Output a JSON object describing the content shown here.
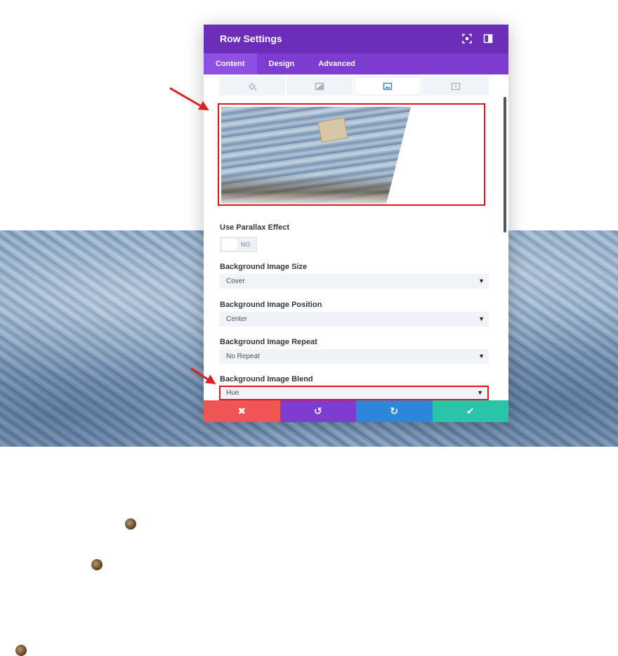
{
  "modal": {
    "title": "Row Settings",
    "header_icons": [
      "fullscreen-icon",
      "sidebar-toggle-icon"
    ]
  },
  "tabs": [
    {
      "label": "Content",
      "active": true
    },
    {
      "label": "Design",
      "active": false
    },
    {
      "label": "Advanced",
      "active": false
    }
  ],
  "background_tabs": [
    {
      "icon": "color-fill-icon",
      "active": false
    },
    {
      "icon": "gradient-icon",
      "active": false
    },
    {
      "icon": "image-icon",
      "active": true
    },
    {
      "icon": "video-icon",
      "active": false
    }
  ],
  "fields": {
    "parallax": {
      "label": "Use Parallax Effect",
      "value": "NO"
    },
    "image_size": {
      "label": "Background Image Size",
      "value": "Cover"
    },
    "image_position": {
      "label": "Background Image Position",
      "value": "Center"
    },
    "image_repeat": {
      "label": "Background Image Repeat",
      "value": "No Repeat"
    },
    "image_blend": {
      "label": "Background Image Blend",
      "value": "Hue"
    }
  },
  "footer": {
    "cancel_symbol": "✖",
    "undo_symbol": "↺",
    "redo_symbol": "↻",
    "save_symbol": "✔"
  },
  "colors": {
    "header": "#6c2eb9",
    "tabs": "#7d3bcf",
    "cancel": "#ef5555",
    "undo": "#7e3bd0",
    "redo": "#2b87da",
    "save": "#29c4a9",
    "annotation": "#e01616"
  }
}
